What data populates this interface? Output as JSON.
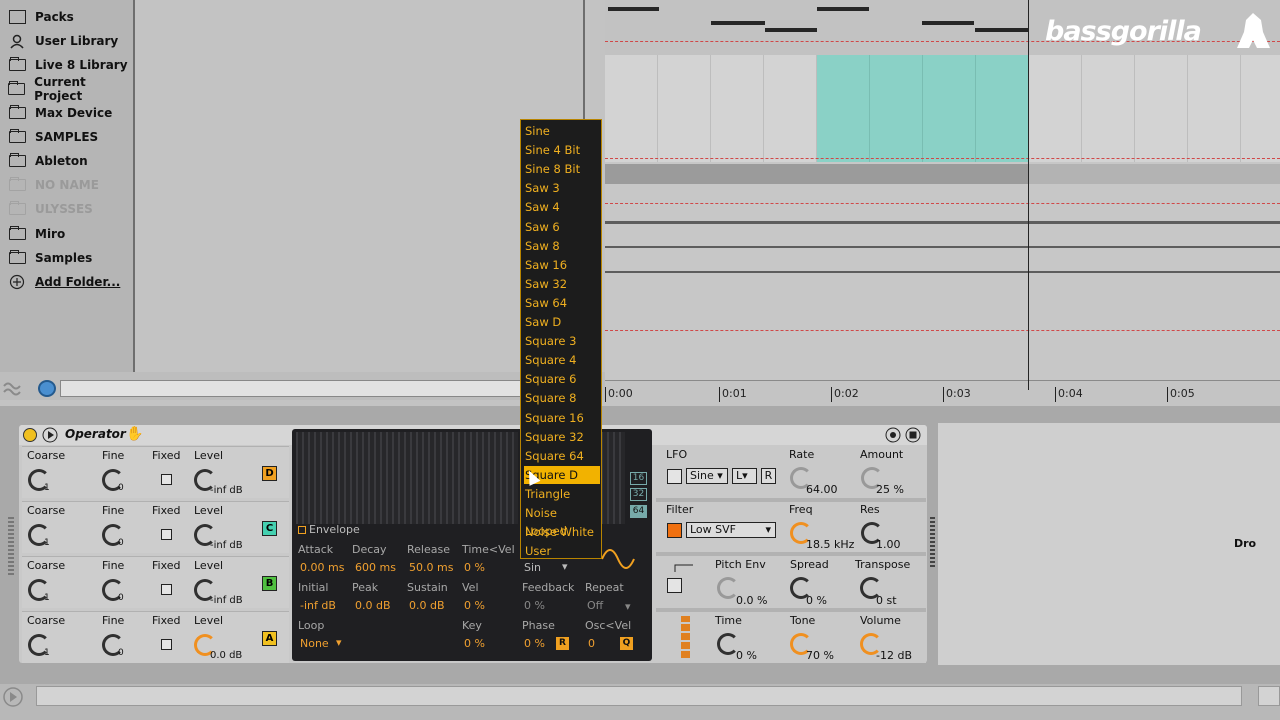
{
  "browser": {
    "items": [
      {
        "label": "Packs",
        "icon": "packs-icon",
        "dim": false
      },
      {
        "label": "User Library",
        "icon": "user-icon",
        "dim": false
      },
      {
        "label": "Live 8 Library",
        "icon": "library-icon",
        "dim": false
      },
      {
        "label": "Current Project",
        "icon": "project-icon",
        "dim": false
      },
      {
        "label": "Max Device",
        "icon": "folder-icon",
        "dim": false
      },
      {
        "label": "SAMPLES",
        "icon": "folder-icon",
        "dim": false
      },
      {
        "label": "Ableton",
        "icon": "folder-icon",
        "dim": false
      },
      {
        "label": "NO NAME",
        "icon": "folder-icon",
        "dim": true
      },
      {
        "label": "ULYSSES",
        "icon": "folder-icon",
        "dim": true
      },
      {
        "label": "Miro",
        "icon": "folder-icon",
        "dim": false
      },
      {
        "label": "Samples",
        "icon": "folder-icon",
        "dim": false
      },
      {
        "label": "Add Folder...",
        "icon": "add-icon",
        "dim": false
      }
    ]
  },
  "logo": "bassgorilla",
  "ruler": {
    "ticks": [
      "0:00",
      "0:01",
      "0:02",
      "0:03",
      "0:04",
      "0:05"
    ]
  },
  "device": {
    "title": "Operator",
    "operators": [
      {
        "letter": "D",
        "color": "#f0a020",
        "coarse": "1",
        "fine": "0",
        "level": "-inf dB"
      },
      {
        "letter": "C",
        "color": "#44d0b0",
        "coarse": "1",
        "fine": "0",
        "level": "-inf dB"
      },
      {
        "letter": "B",
        "color": "#50c040",
        "coarse": "1",
        "fine": "0",
        "level": "-inf dB"
      },
      {
        "letter": "A",
        "color": "#f0c020",
        "coarse": "1",
        "fine": "0",
        "level": "0.0 dB"
      }
    ],
    "op_labels": {
      "coarse": "Coarse",
      "fine": "Fine",
      "fixed": "Fixed",
      "level": "Level"
    },
    "envelope": {
      "title": "Envelope",
      "attack_label": "Attack",
      "attack": "0.00 ms",
      "decay_label": "Decay",
      "decay": "600 ms",
      "release_label": "Release",
      "release": "50.0 ms",
      "timevel_label": "Time<Vel",
      "timevel": "0 %",
      "initial_label": "Initial",
      "initial": "-inf dB",
      "peak_label": "Peak",
      "peak": "0.0 dB",
      "sustain_label": "Sustain",
      "sustain": "0.0 dB",
      "vel_label": "Vel",
      "vel": "0 %",
      "loop_label": "Loop",
      "loop": "None",
      "key_label": "Key",
      "key": "0 %",
      "wave": "Sin",
      "feedback_label": "Feedback",
      "feedback": "0 %",
      "repeat_label": "Repeat",
      "repeat": "Off",
      "phase_label": "Phase",
      "phase": "0 %",
      "oscvel_label": "Osc<Vel",
      "oscvel": "0",
      "wave_sizes": [
        "16",
        "32",
        "64"
      ]
    },
    "lfo": {
      "label": "LFO",
      "wave": "Sine",
      "mode": "L",
      "retrig": "R",
      "rate_label": "Rate",
      "rate": "64.00",
      "amount_label": "Amount",
      "amount": "25 %"
    },
    "filter": {
      "label": "Filter",
      "type": "Low SVF",
      "freq_label": "Freq",
      "freq": "18.5 kHz",
      "res_label": "Res",
      "res": "1.00"
    },
    "pitch": {
      "label": "Pitch Env",
      "value": "0.0 %",
      "spread_label": "Spread",
      "spread": "0 %",
      "transpose_label": "Transpose",
      "transpose": "0 st"
    },
    "global": {
      "time_label": "Time",
      "time": "0 %",
      "tone_label": "Tone",
      "tone": "70 %",
      "volume_label": "Volume",
      "volume": "-12 dB"
    }
  },
  "dropdown": {
    "selected": "Square D",
    "items": [
      "Sine",
      "Sine 4 Bit",
      "Sine 8 Bit",
      "Saw 3",
      "Saw 4",
      "Saw 6",
      "Saw 8",
      "Saw 16",
      "Saw 32",
      "Saw 64",
      "Saw D",
      "Square 3",
      "Square 4",
      "Square 6",
      "Square 8",
      "Square 16",
      "Square 32",
      "Square 64",
      "Square D",
      "Triangle",
      "Noise Looped",
      "Noise White",
      "User"
    ]
  },
  "right_partial": "Dro",
  "colors": {
    "accent": "#f0a020",
    "clip": "#8ad1c6",
    "dropdown_text": "#f0b020"
  }
}
